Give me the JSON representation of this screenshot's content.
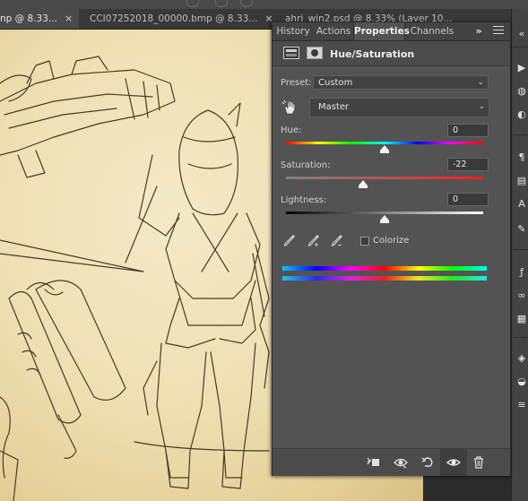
{
  "doc_tabs": [
    {
      "label": "np @ 8.33...",
      "close": "×",
      "active": true
    },
    {
      "label": "CCI07252018_00000.bmp @ 8.33...",
      "close": "×",
      "active": false
    },
    {
      "label": "ahri_win2.psd @ 8.33% (Layer 10...",
      "close": "",
      "active": false
    }
  ],
  "panel": {
    "tabs": [
      "History",
      "Actions",
      "Properties",
      "Channels"
    ],
    "active_tab": "Properties",
    "collapse_glyph": "»",
    "title": "Hue/Saturation",
    "preset_label": "Preset:",
    "preset_value": "Custom",
    "channel_value": "Master",
    "hue": {
      "label": "Hue:",
      "value": "0",
      "position": 0.5
    },
    "saturation": {
      "label": "Saturation:",
      "value": "-22",
      "position": 0.39
    },
    "lightness": {
      "label": "Lightness:",
      "value": "0",
      "position": 0.5
    },
    "colorize_label": "Colorize",
    "colorize_checked": false
  },
  "colors": {
    "panel_bg": "#535353",
    "tab_bar_bg": "#434343",
    "canvas_paper": "#efe0b4",
    "sketch_ink": "#4a3a20"
  },
  "icons": [
    "adjustment-layer-icon",
    "mask-icon",
    "targeted-adjustment-hand-icon",
    "eyedropper-icon",
    "eyedropper-add-icon",
    "eyedropper-subtract-icon",
    "clip-to-layer-icon",
    "view-previous-state-icon",
    "reset-icon",
    "visibility-eye-icon",
    "trash-icon"
  ]
}
